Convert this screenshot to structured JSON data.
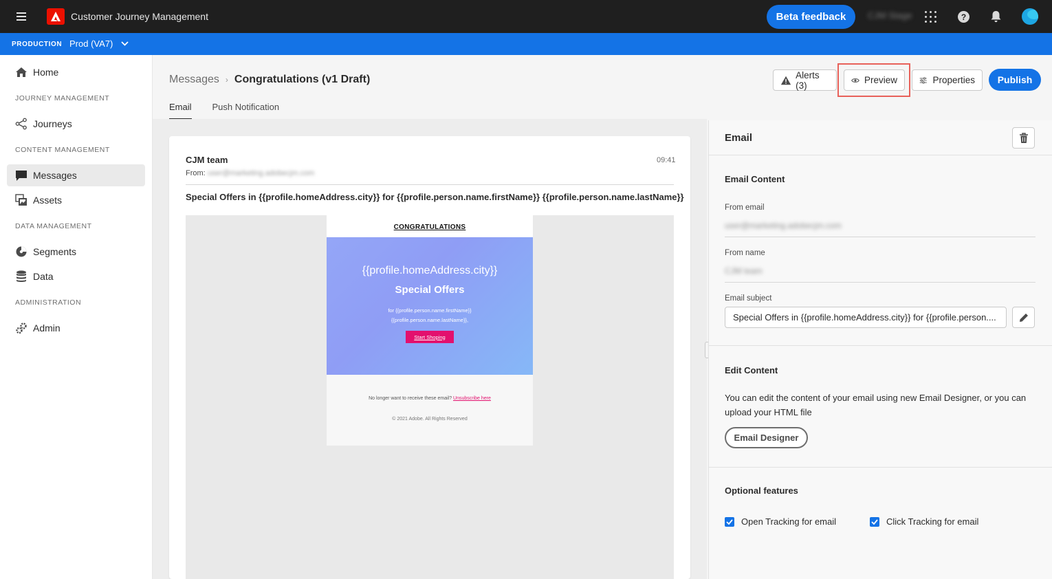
{
  "header": {
    "app_title": "Customer Journey Management",
    "beta_feedback": "Beta feedback",
    "org_name": "CJM Stage"
  },
  "env": {
    "label": "PRODUCTION",
    "sandbox": "Prod (VA7)"
  },
  "sidebar": {
    "home": "Home",
    "section_journey": "JOURNEY MANAGEMENT",
    "journeys": "Journeys",
    "section_content": "CONTENT MANAGEMENT",
    "messages": "Messages",
    "assets": "Assets",
    "section_data": "DATA MANAGEMENT",
    "segments": "Segments",
    "data": "Data",
    "section_admin": "ADMINISTRATION",
    "admin": "Admin"
  },
  "breadcrumb": {
    "parent": "Messages",
    "current": "Congratulations (v1 Draft)"
  },
  "tabs": [
    "Email",
    "Push Notification"
  ],
  "actions": {
    "alerts": "Alerts (3)",
    "preview": "Preview",
    "properties": "Properties",
    "publish": "Publish"
  },
  "preview": {
    "sender": "CJM team",
    "time": "09:41",
    "from_label": "From:",
    "from_email": "user@marketing.adobecjm.com",
    "subject": "Special Offers in {{profile.homeAddress.city}} for {{profile.person.name.firstName}} {{profile.person.name.lastName}}",
    "email": {
      "heading": "CONGRATULATIONS",
      "city": "{{profile.homeAddress.city}}",
      "offers": "Special Offers",
      "names_line1": "for {{profile.person.name.firstName}}",
      "names_line2": "{{profile.person.name.lastName}},",
      "cta": "Start Shoping",
      "unsub_text": "No longer want to receive these email?",
      "unsub_link": "Unsubscribe here",
      "copyright": "© 2021 Adobe. All Rights Reserved"
    }
  },
  "panel": {
    "title": "Email",
    "content_title": "Email Content",
    "from_email_label": "From email",
    "from_email_value": "user@marketing.adobecjm.com",
    "from_name_label": "From name",
    "from_name_value": "CJM team",
    "subject_label": "Email subject",
    "subject_value": "Special Offers in {{profile.homeAddress.city}} for {{profile.person....",
    "edit_title": "Edit Content",
    "edit_desc": "You can edit the content of your email using new Email Designer, or you can upload your HTML file",
    "designer_button": "Email Designer",
    "optional_title": "Optional features",
    "open_tracking": "Open Tracking for email",
    "click_tracking": "Click Tracking for email"
  },
  "colors": {
    "accent": "#1473e6",
    "topbar": "#1f1f1f",
    "highlight": "#e8615a",
    "cta": "#e3106e"
  }
}
